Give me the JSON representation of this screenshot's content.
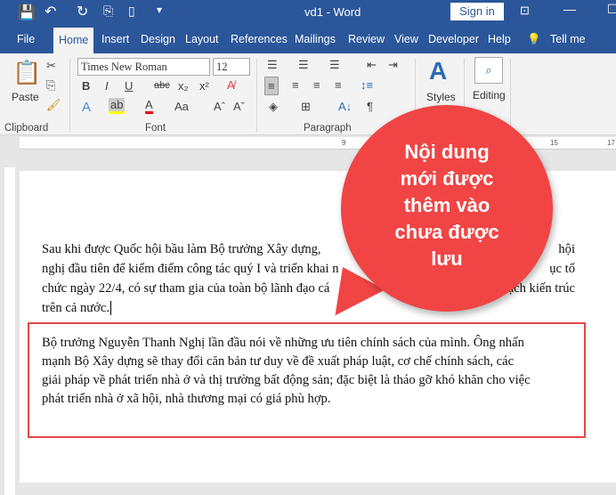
{
  "titlebar": {
    "title": "vd1  -  Word",
    "sign_in": "Sign in"
  },
  "tabs": [
    "File",
    "Home",
    "Insert",
    "Design",
    "Layout",
    "References",
    "Mailings",
    "Review",
    "View",
    "Developer",
    "Help",
    "Tell me"
  ],
  "ribbon": {
    "font_name": "Times New Roman",
    "font_size": "12",
    "paste": "Paste",
    "styles": "Styles",
    "editing": "Editing",
    "groups": {
      "clipboard": "Clipboard",
      "font": "Font",
      "paragraph": "Paragraph"
    }
  },
  "ruler": {
    "marks": [
      "9",
      "15",
      "17"
    ]
  },
  "doc": {
    "p1": [
      "Sau khi được Quốc hội bầu làm Bộ trưởng Xây dựng, ",
      "nghị đầu tiên để kiểm điểm công tác quý I và triển khai n",
      "chức ngày 22/4, có sự tham gia của toàn bộ lãnh đạo cá",
      "trên cả nước."
    ],
    "p1_right": [
      "hội",
      "ục tổ",
      "ạch kiến trúc"
    ],
    "p2": [
      "Bộ trưởng Nguyễn Thanh Nghị lần đầu nói về những ưu tiên chính sách của mình. Ông nhấn",
      "mạnh Bộ Xây dựng sẽ thay đổi căn bản tư duy về đề xuất pháp luật, cơ chế chính sách, các",
      "giải pháp về phát triển nhà ở và thị trường bất động sản; đặc biệt là tháo gỡ khó khăn cho việc",
      "phát triển nhà ở xã hội, nhà thương mại có giá phù hợp."
    ]
  },
  "callout": {
    "lines": [
      "Nội dung",
      "mới được",
      "thêm vào",
      "chưa được",
      "lưu"
    ],
    "color": "#f14545"
  }
}
